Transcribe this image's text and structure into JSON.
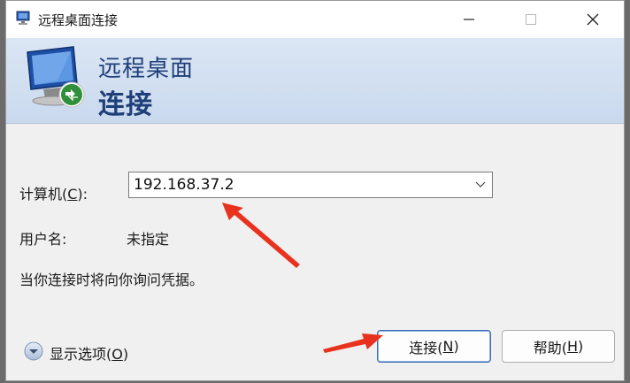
{
  "window": {
    "title": "远程桌面连接",
    "controls": [
      "minimize-icon",
      "maximize-icon",
      "close-icon"
    ]
  },
  "banner": {
    "line1": "远程桌面",
    "line2": "连接"
  },
  "form": {
    "computer_label_pre": "计算机(",
    "computer_label_key": "C",
    "computer_label_post": "):",
    "computer_value": "192.168.37.2",
    "username_label": "用户名:",
    "username_value": "未指定",
    "info_text": "当你连接时将向你询问凭据。"
  },
  "footer": {
    "options_pre": "显示选项(",
    "options_key": "O",
    "options_post": ")",
    "connect_pre": "连接(",
    "connect_key": "N",
    "connect_post": ")",
    "help_pre": "帮助(",
    "help_key": "H",
    "help_post": ")"
  },
  "colors": {
    "annotation_arrow": "#e8321e",
    "banner_text": "#1f3f7a",
    "primary_border": "#3a6ab0"
  }
}
